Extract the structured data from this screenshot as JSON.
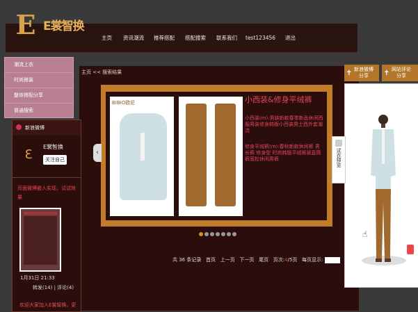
{
  "brand": {
    "logo_mark": "E",
    "name": "E裳智换"
  },
  "nav": [
    "主页",
    "资讯潮流",
    "推荐搭配",
    "搭配搜索",
    "联系我们",
    "test123456",
    "退出"
  ],
  "dropdown": [
    "潮流上衣",
    "时尚搭装",
    "整体搭配分享",
    "普通搜索"
  ],
  "left": {
    "title": "新浪微博",
    "user": "E裳智换",
    "follow": "关注自己",
    "message": "页面微博嵌入实现，试试效果",
    "date": "1月31日 21:33",
    "stats": "转发(14) | 评论(4)",
    "footer": "欢迎大家加入E裳智换，更"
  },
  "breadcrumb": "主页 << 搜索结果",
  "product": {
    "brand_label": "BIBIO欧尼",
    "title": "小西装&修身平绒裤",
    "desc1": "小西装(m):男装新款春季新品休闲西服男装修身韩版小西装男士西外套潮流",
    "desc2": "修身平绒裤(m):春秋新款休闲裤 男 长裤 修身型 时尚韩版平绒裤装直筒裤宽松休闲男裤"
  },
  "pager": {
    "total": "共 36 条记录",
    "first": "首页",
    "prev": "上一页",
    "next": "下一页",
    "last": "尾页",
    "pageinfo_prefix": "页次:",
    "pageinfo_cur": "4",
    "pageinfo_rest": "/5页",
    "per_page": "每页显示:"
  },
  "right": {
    "share_weibo": [
      "新浪微博",
      "分享"
    ],
    "share_site": [
      "网站评论",
      "分享"
    ],
    "tryon_tab": "试衣预览"
  },
  "colors": {
    "accent": "#c27d2a",
    "menu": "#b87e93",
    "bg": "#2b0e0c",
    "red_text": "#e0455a"
  }
}
